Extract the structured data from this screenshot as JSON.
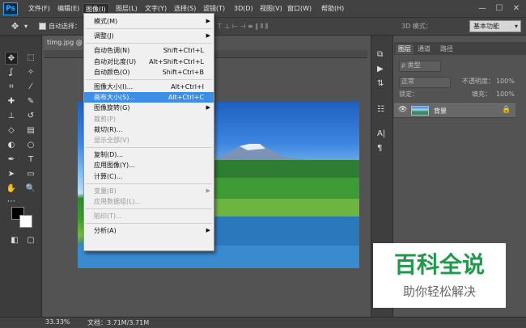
{
  "app": {
    "logo": "Ps"
  },
  "menubar": {
    "items": [
      "文件(F)",
      "编辑(E)",
      "图像(I)",
      "图层(L)",
      "文字(Y)",
      "选择(S)",
      "滤镜(T)",
      "3D(D)",
      "视图(V)",
      "窗口(W)",
      "帮助(H)"
    ],
    "active_index": 2
  },
  "window_controls": {
    "minimize": "—",
    "maximize": "☐",
    "close": "✕"
  },
  "options_bar": {
    "auto_select_label": "自动选择：",
    "mode_3d": "3D 模式：",
    "preset": "基本功能"
  },
  "document": {
    "tab": "timg.jpg @"
  },
  "image_menu": {
    "items": [
      {
        "label": "模式(M)",
        "shortcut": "",
        "submenu": true,
        "disabled": false
      },
      {
        "sep": true
      },
      {
        "label": "调整(J)",
        "shortcut": "",
        "submenu": true,
        "disabled": false
      },
      {
        "sep": true
      },
      {
        "label": "自动色调(N)",
        "shortcut": "Shift+Ctrl+L",
        "submenu": false,
        "disabled": false
      },
      {
        "label": "自动对比度(U)",
        "shortcut": "Alt+Shift+Ctrl+L",
        "submenu": false,
        "disabled": false
      },
      {
        "label": "自动颜色(O)",
        "shortcut": "Shift+Ctrl+B",
        "submenu": false,
        "disabled": false
      },
      {
        "sep": true
      },
      {
        "label": "图像大小(I)...",
        "shortcut": "Alt+Ctrl+I",
        "submenu": false,
        "disabled": false
      },
      {
        "label": "画布大小(S)...",
        "shortcut": "Alt+Ctrl+C",
        "submenu": false,
        "disabled": false,
        "highlighted": true
      },
      {
        "label": "图像旋转(G)",
        "shortcut": "",
        "submenu": true,
        "disabled": false
      },
      {
        "label": "裁剪(P)",
        "shortcut": "",
        "submenu": false,
        "disabled": true
      },
      {
        "label": "裁切(R)...",
        "shortcut": "",
        "submenu": false,
        "disabled": false
      },
      {
        "label": "显示全部(V)",
        "shortcut": "",
        "submenu": false,
        "disabled": true
      },
      {
        "sep": true
      },
      {
        "label": "复制(D)...",
        "shortcut": "",
        "submenu": false,
        "disabled": false
      },
      {
        "label": "应用图像(Y)...",
        "shortcut": "",
        "submenu": false,
        "disabled": false
      },
      {
        "label": "计算(C)...",
        "shortcut": "",
        "submenu": false,
        "disabled": false
      },
      {
        "sep": true
      },
      {
        "label": "变量(B)",
        "shortcut": "",
        "submenu": true,
        "disabled": true
      },
      {
        "label": "应用数据组(L)...",
        "shortcut": "",
        "submenu": false,
        "disabled": true
      },
      {
        "sep": true
      },
      {
        "label": "陷印(T)...",
        "shortcut": "",
        "submenu": false,
        "disabled": true
      },
      {
        "sep": true
      },
      {
        "label": "分析(A)",
        "shortcut": "",
        "submenu": true,
        "disabled": false
      }
    ]
  },
  "layers_panel": {
    "tabs": [
      "图层",
      "通道",
      "路径"
    ],
    "kind": "ρ 类型",
    "blend_mode": "正常",
    "opacity_label": "不透明度：",
    "opacity": "100%",
    "lock_label": "锁定：",
    "fill_label": "填充：",
    "fill": "100%",
    "layer_name": "背景"
  },
  "status_bar": {
    "zoom": "33.33%",
    "doc_info": "文档：3.71M/3.71M"
  },
  "watermark": {
    "line1": "百科全说",
    "line2": "助你轻松解决"
  }
}
